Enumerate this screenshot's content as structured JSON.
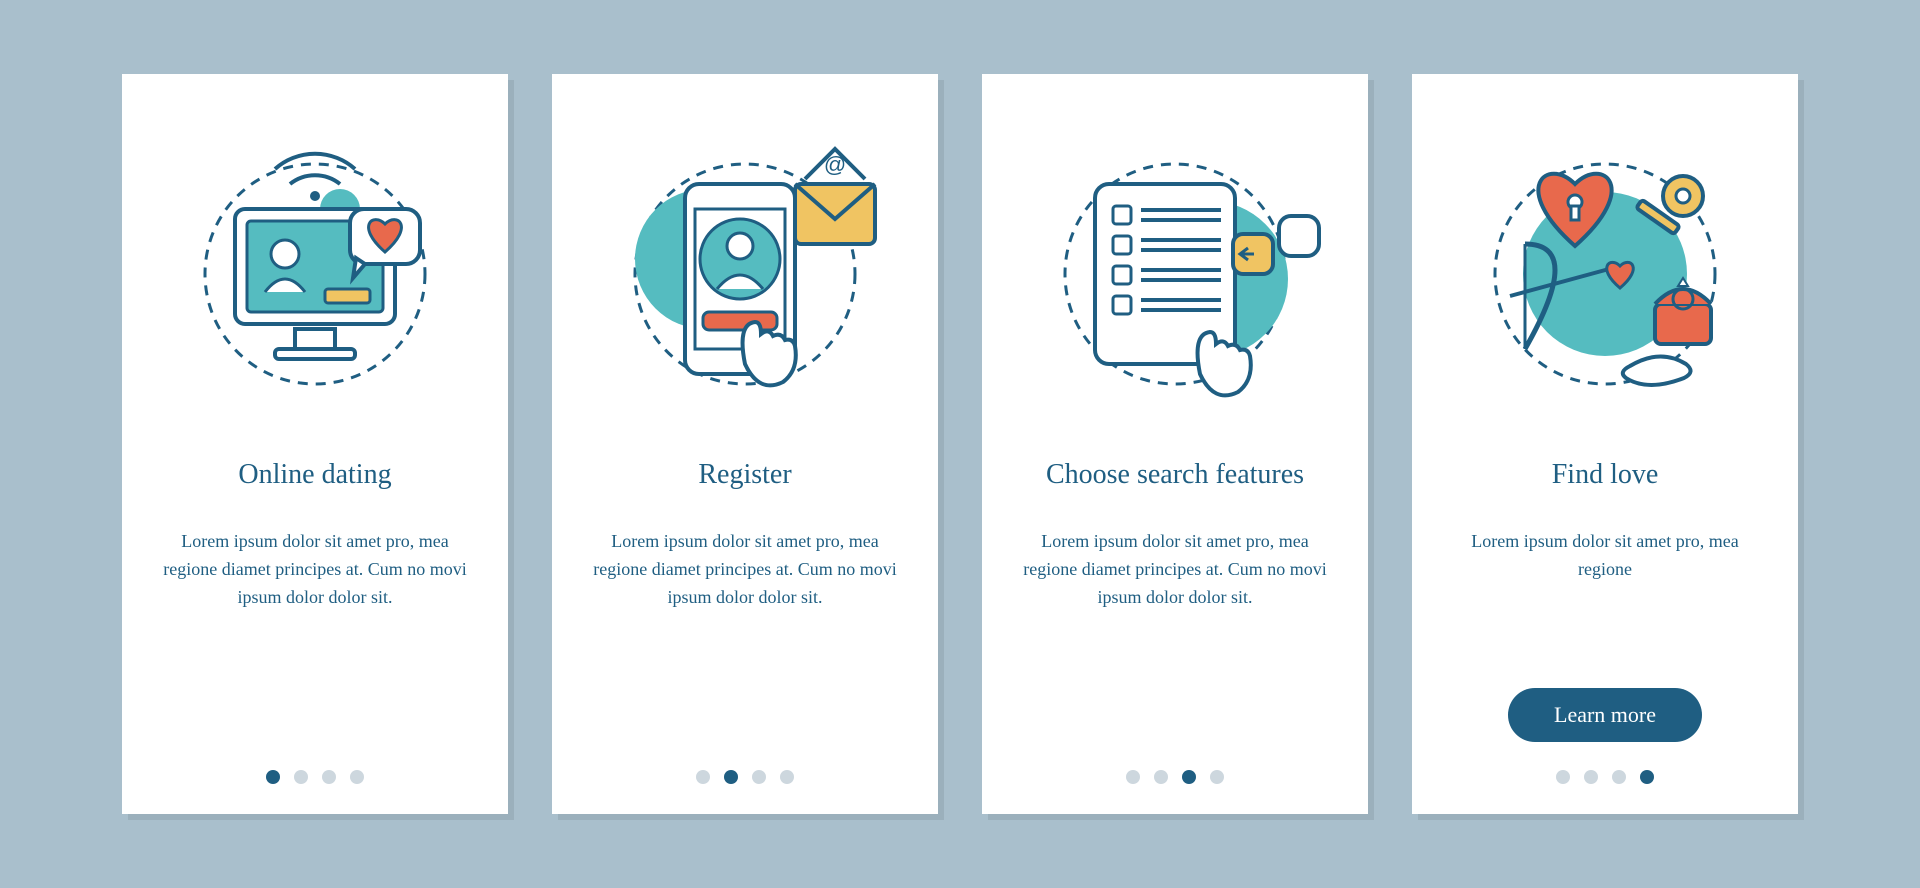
{
  "colors": {
    "pageBg": "#a9bfcc",
    "cardBg": "#ffffff",
    "text": "#1f5e82",
    "accentTeal": "#55bcc0",
    "accentOrange": "#e8694c",
    "accentYellow": "#f0c462",
    "dotInactive": "#cdd7de",
    "dotActive": "#1f5e82"
  },
  "cta_label": "Learn more",
  "cards": [
    {
      "icon": "online-dating-icon",
      "title": "Online dating",
      "body": "Lorem ipsum dolor sit amet pro, mea regione diamet principes at. Cum no movi ipsum dolor dolor sit.",
      "activeDot": 0,
      "cta": false
    },
    {
      "icon": "register-icon",
      "title": "Register",
      "body": "Lorem ipsum dolor sit amet pro, mea regione diamet principes at. Cum no movi ipsum dolor dolor sit.",
      "activeDot": 1,
      "cta": false
    },
    {
      "icon": "search-features-icon",
      "title": "Choose search features",
      "body": "Lorem ipsum dolor sit amet pro, mea regione diamet principes at. Cum no movi ipsum dolor dolor sit.",
      "activeDot": 2,
      "cta": false
    },
    {
      "icon": "find-love-icon",
      "title": "Find love",
      "body": "Lorem ipsum dolor sit amet pro, mea regione",
      "activeDot": 3,
      "cta": true
    }
  ]
}
